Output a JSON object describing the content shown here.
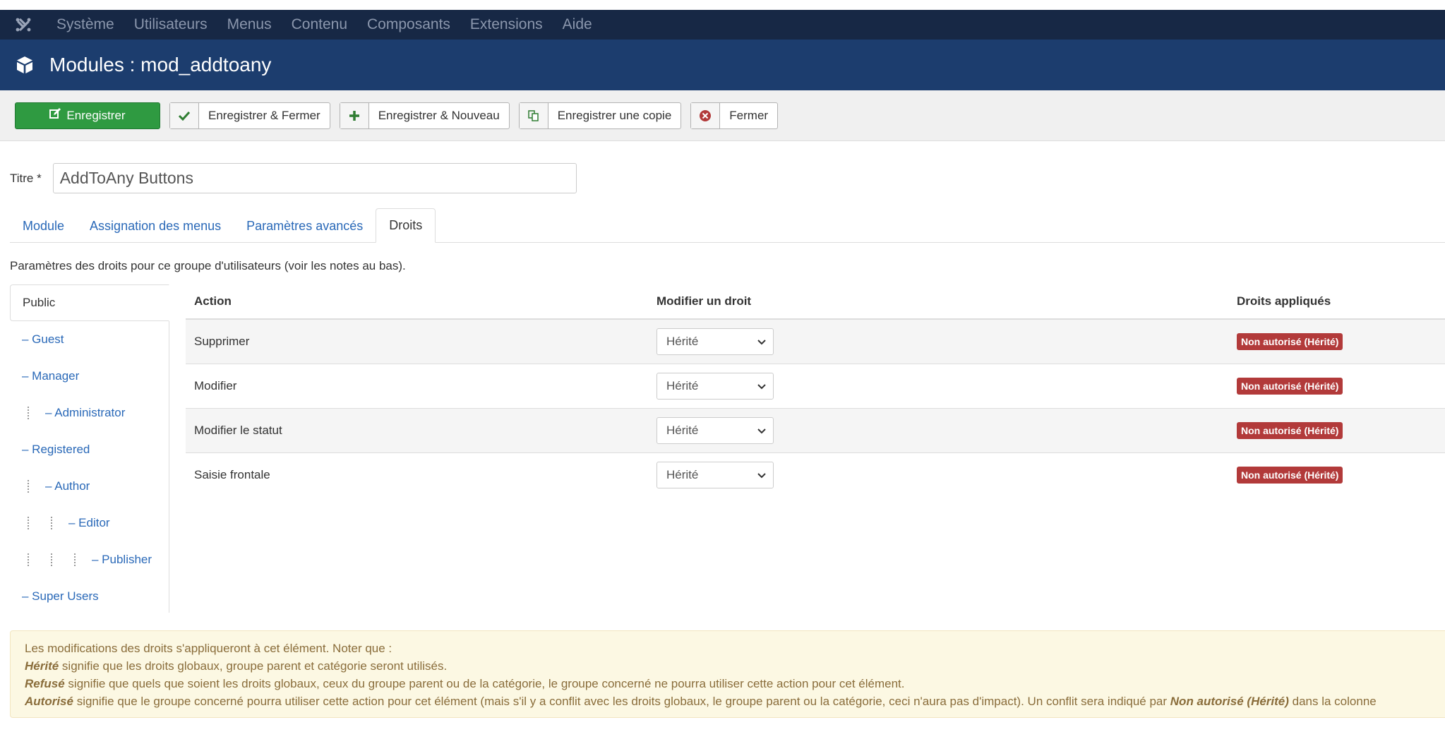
{
  "nav": {
    "items": [
      "Système",
      "Utilisateurs",
      "Menus",
      "Contenu",
      "Composants",
      "Extensions",
      "Aide"
    ]
  },
  "header": {
    "title": "Modules : mod_addtoany"
  },
  "toolbar": {
    "save_label": "Enregistrer",
    "save_close_label": "Enregistrer & Fermer",
    "save_new_label": "Enregistrer & Nouveau",
    "save_copy_label": "Enregistrer une copie",
    "close_label": "Fermer"
  },
  "form": {
    "title_label": "Titre *",
    "title_value": "AddToAny Buttons"
  },
  "tabs": [
    "Module",
    "Assignation des menus",
    "Paramètres avancés",
    "Droits"
  ],
  "permissions": {
    "intro": "Paramètres des droits pour ce groupe d'utilisateurs (voir les notes au bas).",
    "groups": [
      {
        "label": "Public",
        "depth": 0
      },
      {
        "label": "– Guest",
        "depth": 0
      },
      {
        "label": "– Manager",
        "depth": 0
      },
      {
        "label": "– Administrator",
        "depth": 1
      },
      {
        "label": "– Registered",
        "depth": 0
      },
      {
        "label": "– Author",
        "depth": 1
      },
      {
        "label": "– Editor",
        "depth": 2
      },
      {
        "label": "– Publisher",
        "depth": 3
      },
      {
        "label": "– Super Users",
        "depth": 0
      }
    ],
    "columns": [
      "Action",
      "Modifier un droit",
      "Droits appliqués"
    ],
    "rows": [
      {
        "action": "Supprimer",
        "setting": "Hérité",
        "applied": "Non autorisé (Hérité)"
      },
      {
        "action": "Modifier",
        "setting": "Hérité",
        "applied": "Non autorisé (Hérité)"
      },
      {
        "action": "Modifier le statut",
        "setting": "Hérité",
        "applied": "Non autorisé (Hérité)"
      },
      {
        "action": "Saisie frontale",
        "setting": "Hérité",
        "applied": "Non autorisé (Hérité)"
      }
    ]
  },
  "notes": {
    "line1": "Les modifications des droits s'appliqueront à cet élément. Noter que :",
    "inherited_term": "Hérité",
    "inherited_text": " signifie que les droits globaux, groupe parent et catégorie seront utilisés.",
    "denied_term": "Refusé",
    "denied_text": " signifie que quels que soient les droits globaux, ceux du groupe parent ou de la catégorie, le groupe concerné ne pourra utiliser cette action pour cet élément.",
    "allowed_term": "Autorisé",
    "allowed_text": " signifie que le groupe concerné pourra utiliser cette action pour cet élément (mais s'il y a conflit avec les droits globaux, le groupe parent ou la catégorie, ceci n'aura pas d'impact). Un conflit sera indiqué par ",
    "conflict_term": "Non autorisé (Hérité)",
    "allowed_text_end": " dans la colonne"
  },
  "colors": {
    "navbar": "#172845",
    "header": "#1c3d6e",
    "primary": "#2f9a41",
    "link": "#2a69b8",
    "badge_danger": "#b23a3a",
    "note_bg": "#fcf8e3"
  }
}
